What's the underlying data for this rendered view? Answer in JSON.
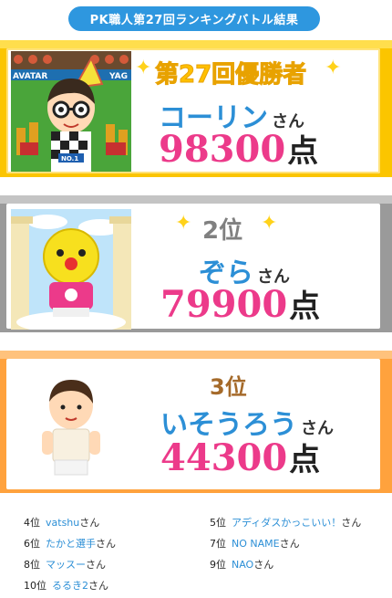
{
  "header": {
    "title": "PK職人第27回ランキングバトル結果"
  },
  "first": {
    "title": "第27回優勝者",
    "name": "コーリン",
    "san": "さん",
    "score": "98300",
    "score_unit": "点",
    "banner_left": "AVATAR",
    "banner_right": "YAG",
    "badge": "NO.1"
  },
  "second": {
    "title": "2位",
    "name": "ぞら",
    "san": "さん",
    "score": "79900",
    "score_unit": "点"
  },
  "third": {
    "title": "3位",
    "name": "いそうろう",
    "san": "さん",
    "score": "44300",
    "score_unit": "点"
  },
  "others": [
    {
      "pos": "4位",
      "name": "vatshu",
      "san": "さん"
    },
    {
      "pos": "5位",
      "name": "アディダスかっこいい！",
      "san": "さん"
    },
    {
      "pos": "6位",
      "name": "たかと選手",
      "san": "さん"
    },
    {
      "pos": "7位",
      "name": "NO NAME",
      "san": "さん"
    },
    {
      "pos": "8位",
      "name": "マッスー",
      "san": "さん"
    },
    {
      "pos": "9位",
      "name": "NAO",
      "san": "さん"
    },
    {
      "pos": "10位",
      "name": "るるき2",
      "san": "さん"
    }
  ],
  "colors": {
    "accent_blue": "#2e97df",
    "gold": "#fbc500",
    "silver": "#9a9a9a",
    "bronze": "#ffa23d",
    "score_pink": "#ec3a8a"
  }
}
